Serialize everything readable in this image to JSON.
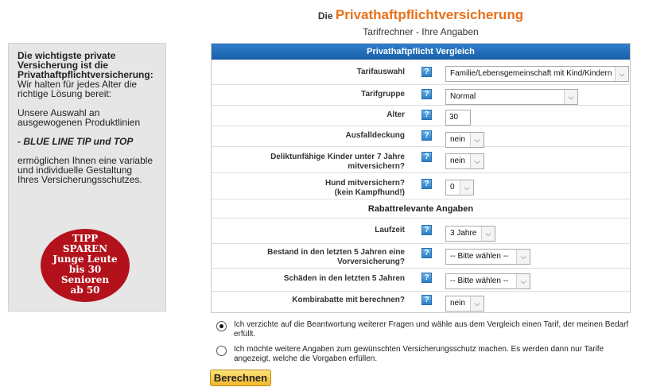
{
  "header": {
    "prefix": "Die",
    "brand": "Privathaftpflichtversicherung",
    "subtitle": "Tarifrechner - Ihre Angaben"
  },
  "sidebar": {
    "line1": "Die wichtigste private",
    "line2": "Versicherung ist die",
    "line3": "Privathaftpflichtversicherung:",
    "line4": "Wir halten für jedes Alter die",
    "line5": "richtige Lösung bereit:",
    "line6": "Unsere Auswahl an",
    "line7": "ausgewogenen Produktlinien",
    "line8": "- BLUE LINE TIP und TOP",
    "line9": "ermöglichen Ihnen eine variable",
    "line10": "und individuelle Gestaltung",
    "line11": "Ihres Versicherungsschutzes.",
    "badge": [
      "TIPP",
      "SPAREN",
      "Junge Leute",
      "bis 30",
      "Senioren",
      "ab 50"
    ]
  },
  "form": {
    "head": "Privathaftpflicht Vergleich",
    "help_glyph": "?",
    "arrow_glyph": "⌵",
    "rows": [
      {
        "label": "Tarifauswahl",
        "value": "Familie/Lebensgemeinschaft mit Kind/Kindern"
      },
      {
        "label": "Tarifgruppe",
        "value": "Normal"
      },
      {
        "label": "Alter",
        "value": "30"
      },
      {
        "label": "Ausfalldeckung",
        "value": "nein"
      },
      {
        "label": "Deliktunfähige Kinder unter 7 Jahre",
        "label2": "mitversichern?",
        "value": "nein"
      },
      {
        "label": "Hund mitversichern?",
        "label2": "(kein Kampfhund!)",
        "value": "0"
      },
      {
        "label": "Laufzeit",
        "value": "3 Jahre"
      },
      {
        "label": "Bestand in den letzten 5 Jahren eine",
        "label2": "Vorversicherung?",
        "value": "-- Bitte wählen --"
      },
      {
        "label": "Schäden in den letzten 5 Jahren",
        "value": "-- Bitte wählen --"
      },
      {
        "label": "Kombirabatte mit berechnen?",
        "value": "nein"
      }
    ],
    "section": "Rabattrelevante Angaben"
  },
  "options": [
    {
      "text": "Ich verzichte auf die Beantwortung weiterer Fragen und wähle aus dem Vergleich einen Tarif, der meinen Bedarf erfüllt.",
      "checked": true
    },
    {
      "text": "Ich möchte weitere Angaben zum gewünschten Versicherungsschutz machen. Es werden dann nur Tarife angezeigt, welche die Vorgaben erfüllen.",
      "checked": false
    }
  ],
  "submit_label": "Berechnen"
}
